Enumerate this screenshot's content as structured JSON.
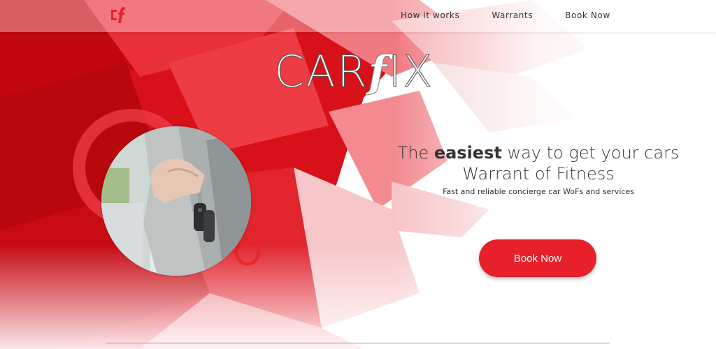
{
  "nav": {
    "items": [
      {
        "label": "How it works"
      },
      {
        "label": "Warrants"
      },
      {
        "label": "Book Now"
      }
    ]
  },
  "brand": {
    "logo_text": "cf",
    "word_prefix": "CAR",
    "word_f": "f",
    "word_suffix": "IX"
  },
  "hero": {
    "headline_prefix": "The ",
    "headline_strong": "easiest",
    "headline_rest": " way to get your cars",
    "headline_line2": "Warrant of Fitness",
    "subline": "Fast and reliable concierge car WoFs and services",
    "cta_label": "Book Now"
  },
  "colors": {
    "accent": "#e8202a",
    "text": "#333333"
  }
}
